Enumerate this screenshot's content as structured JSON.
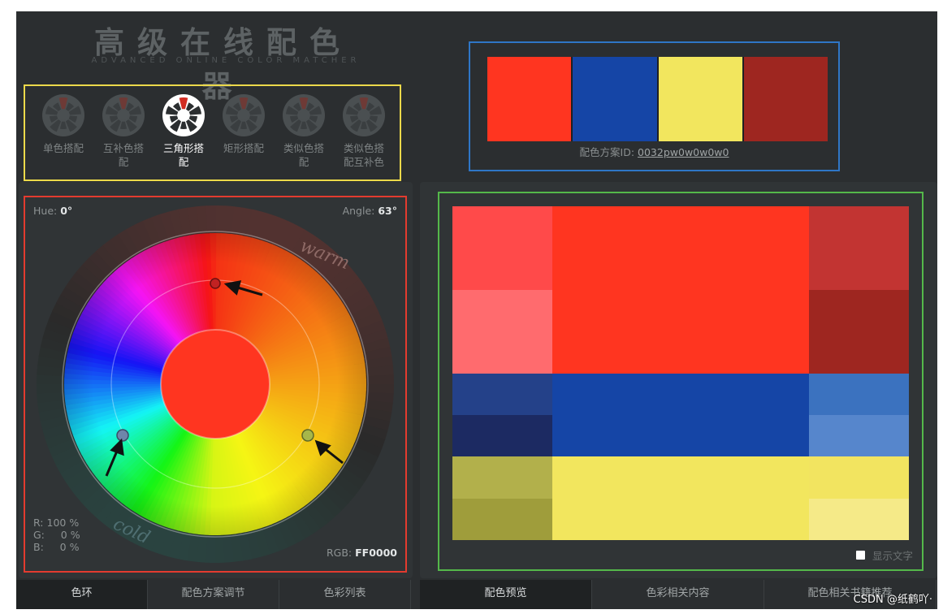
{
  "header": {
    "title": "高级在线配色器",
    "subtitle": "ADVANCED ONLINE COLOR MATCHER"
  },
  "modes": [
    {
      "label": "单色搭配",
      "icon": "mono-wheel-icon",
      "active": false
    },
    {
      "label": "互补色搭配",
      "icon": "complement-wheel-icon",
      "active": false
    },
    {
      "label": "三角形搭配",
      "icon": "triad-wheel-icon",
      "active": true
    },
    {
      "label": "矩形搭配",
      "icon": "tetrad-wheel-icon",
      "active": false
    },
    {
      "label": "类似色搭配",
      "icon": "analogic-wheel-icon",
      "active": false
    },
    {
      "label": "类似色搭配互补色",
      "icon": "analogic-complement-wheel-icon",
      "active": false
    }
  ],
  "scheme": {
    "swatches": [
      "#ff3520",
      "#1545a6",
      "#f2e65e",
      "#9e2620"
    ],
    "id_label": "配色方案ID: ",
    "id_value": "0032pw0w0w0w0"
  },
  "wheel": {
    "hue_label": "Hue: ",
    "hue_value": "0°",
    "angle_label": "Angle: ",
    "angle_value": "63°",
    "warm_label": "warm",
    "cold_label": "cold",
    "r_line": "R: 100 %",
    "g_line": "G:     0 %",
    "b_line": "B:     0 %",
    "rgb_label": "RGB: ",
    "rgb_value": "FF0000",
    "center_color": "#ff3520"
  },
  "preview": {
    "columns": {
      "left": [
        "#ff4a4a",
        "#ff6b6e",
        "#244189",
        "#1c2a62",
        "#b2b04b",
        "#9f9d3b"
      ],
      "middle": [
        "#ff3520",
        "#1545a6",
        "#f2e65e"
      ],
      "right": [
        "#c23432",
        "#9e2620",
        "#3b72bf",
        "#5686cc",
        "#f2e460",
        "#f5ea88"
      ]
    },
    "show_text_label": "显示文字"
  },
  "tabs_left": [
    {
      "label": "色环",
      "active": true
    },
    {
      "label": "配色方案调节",
      "active": false
    },
    {
      "label": "色彩列表",
      "active": false
    }
  ],
  "tabs_right": [
    {
      "label": "配色预览",
      "active": true
    },
    {
      "label": "色彩相关内容",
      "active": false
    },
    {
      "label": "配色相关书籍推荐",
      "active": false
    }
  ],
  "watermark": "CSDN @纸鹤吖·"
}
